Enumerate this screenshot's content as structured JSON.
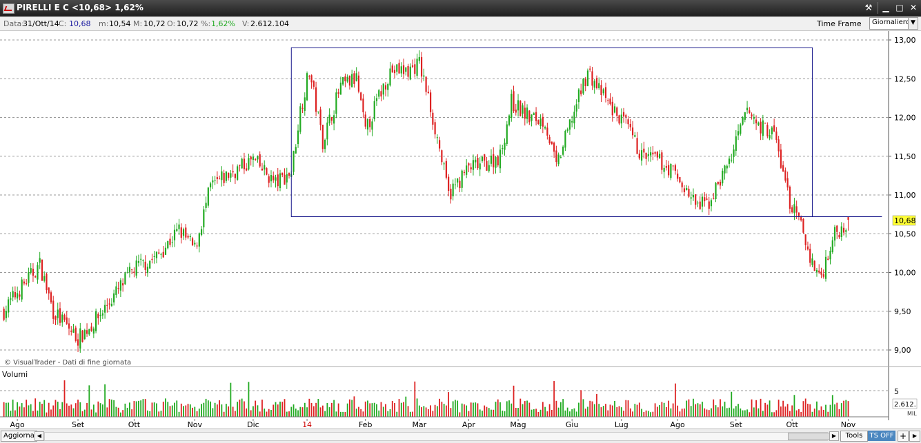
{
  "window": {
    "title": "PIRELLI E C <10,68> 1,62%",
    "tools_icon": "wrench-icon",
    "minimize_icon": "minimize-icon",
    "maximize_icon": "maximize-icon",
    "close_icon": "close-icon",
    "minimize_glyph": "▁",
    "maximize_glyph": "□",
    "close_glyph": "✕",
    "tools_glyph": "⚒"
  },
  "infobar": {
    "date_label": "Data:",
    "date_value": "31/Ott/14",
    "close_label": "C:",
    "close_value": "10,68",
    "min_label": "m:",
    "min_value": "10,54",
    "max_label": "M:",
    "max_value": "10,72",
    "open_label": "O:",
    "open_value": "10,72",
    "pct_label": "%:",
    "pct_value": "1,62%",
    "vol_label": "V:",
    "vol_value": "2.612.104",
    "timeframe_label": "Time Frame",
    "timeframe_value": "Giornaliero"
  },
  "colors": {
    "up": "#22aa22",
    "down": "#dd2222",
    "rect": "#1a1a8c",
    "grid": "#9a9a9a",
    "price_badge": "#ffff33",
    "ts_off": "#4b87c0"
  },
  "bottombar": {
    "refresh_label": "Aggiorna",
    "tools_label": "Tools",
    "ts_label": "TS OFF",
    "plus_label": "+",
    "left_arrow": "◀",
    "right_arrow": "▶"
  },
  "chart_data": {
    "type": "candlestick",
    "symbol": "PIRELLI E C",
    "credit": "© VisualTrader - Dati di fine giornata",
    "price_axis": {
      "ticks": [
        "13,00",
        "12,50",
        "12,00",
        "11,50",
        "11,00",
        "10,50",
        "10,00",
        "9,50",
        "9,00"
      ],
      "values": [
        13,
        12.5,
        12,
        11.5,
        11,
        10.5,
        10,
        9.5,
        9
      ],
      "min": 8.9,
      "max": 13.1
    },
    "last_price_label": "10,68",
    "last_price": 10.68,
    "month_labels": [
      "Ago",
      "Set",
      "Ott",
      "Nov",
      "Dic",
      "14",
      "Feb",
      "Mar",
      "Apr",
      "Mag",
      "Giu",
      "Lug",
      "Ago",
      "Set",
      "Ott",
      "Nov"
    ],
    "month_start_index": [
      6,
      33,
      58,
      85,
      111,
      135,
      161,
      185,
      207,
      229,
      253,
      275,
      300,
      326,
      351,
      376
    ],
    "price_anchors": [
      [
        0,
        9.5
      ],
      [
        6,
        9.75
      ],
      [
        16,
        10.1
      ],
      [
        22,
        9.5
      ],
      [
        33,
        9.15
      ],
      [
        40,
        9.35
      ],
      [
        58,
        10.05
      ],
      [
        68,
        10.2
      ],
      [
        78,
        10.55
      ],
      [
        85,
        10.3
      ],
      [
        92,
        11.1
      ],
      [
        102,
        11.3
      ],
      [
        111,
        11.45
      ],
      [
        121,
        11.15
      ],
      [
        128,
        11.3
      ],
      [
        132,
        12.1
      ],
      [
        136,
        12.6
      ],
      [
        142,
        11.7
      ],
      [
        150,
        12.4
      ],
      [
        157,
        12.5
      ],
      [
        161,
        11.8
      ],
      [
        166,
        12.2
      ],
      [
        172,
        12.6
      ],
      [
        180,
        12.6
      ],
      [
        185,
        12.7
      ],
      [
        189,
        12.25
      ],
      [
        194,
        11.6
      ],
      [
        198,
        11.0
      ],
      [
        207,
        11.35
      ],
      [
        214,
        11.4
      ],
      [
        221,
        11.5
      ],
      [
        226,
        12.2
      ],
      [
        234,
        12.0
      ],
      [
        241,
        11.95
      ],
      [
        246,
        11.35
      ],
      [
        253,
        12.0
      ],
      [
        260,
        12.6
      ],
      [
        264,
        12.4
      ],
      [
        271,
        12.1
      ],
      [
        277,
        11.9
      ],
      [
        284,
        11.5
      ],
      [
        291,
        11.45
      ],
      [
        298,
        11.3
      ],
      [
        305,
        11.0
      ],
      [
        309,
        10.85
      ],
      [
        314,
        10.9
      ],
      [
        324,
        11.5
      ],
      [
        331,
        12.1
      ],
      [
        336,
        11.9
      ],
      [
        343,
        11.8
      ],
      [
        350,
        10.9
      ],
      [
        355,
        10.6
      ],
      [
        360,
        10.1
      ],
      [
        364,
        9.95
      ],
      [
        369,
        10.45
      ],
      [
        372,
        10.55
      ],
      [
        376,
        10.68
      ]
    ],
    "rectangle": {
      "x_start_index": 128,
      "x_end_index": 360,
      "top": 12.9,
      "bottom": 10.72
    },
    "resistance_line": {
      "x_start_index": 360,
      "x_end_index": 391,
      "value": 10.72
    },
    "volume": {
      "title": "Volumi",
      "tick_label": "5",
      "tick_value": 5,
      "last_label": "2.612.",
      "unit_label": "MIL",
      "max": 8,
      "avg": 1.8
    },
    "last_bar": {
      "open": 10.72,
      "high": 10.72,
      "low": 10.54,
      "close": 10.68,
      "volume": 2.612
    }
  }
}
